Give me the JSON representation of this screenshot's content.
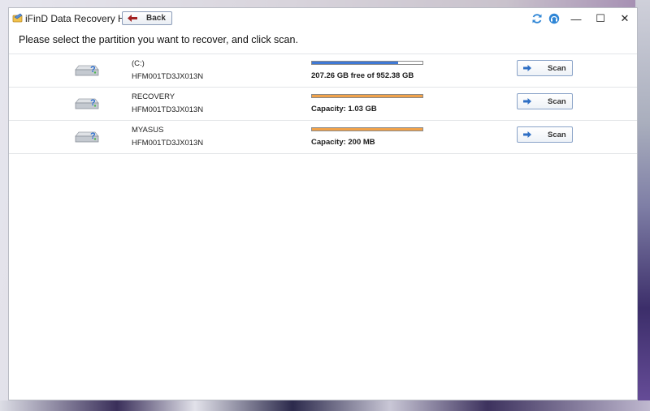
{
  "window": {
    "title": "iFinD Data Recovery Home",
    "back_label": "Back",
    "minimize": "—",
    "maximize": "☐",
    "close": "✕"
  },
  "instruction": "Please select the partition you want to recover, and click scan.",
  "partitions": [
    {
      "name": "(C:)",
      "model": "HFM001TD3JX013N",
      "capacity": "207.26 GB free of 952.38 GB",
      "used_fraction": 0.78,
      "bar_color": "#3f79d6",
      "scan_label": "Scan"
    },
    {
      "name": "RECOVERY",
      "model": "HFM001TD3JX013N",
      "capacity": "Capacity: 1.03 GB",
      "used_fraction": 1.0,
      "bar_color": "#f0a24a",
      "scan_label": "Scan"
    },
    {
      "name": "MYASUS",
      "model": "HFM001TD3JX013N",
      "capacity": "Capacity: 200 MB",
      "used_fraction": 1.0,
      "bar_color": "#f0a24a",
      "scan_label": "Scan"
    }
  ],
  "icons": {
    "app": "key-folder-icon",
    "refresh": "refresh-icon",
    "support": "headset-icon",
    "drive": "hard-drive-question-icon",
    "back_arrow": "back-arrow-icon",
    "scan_arrow": "forward-arrow-icon"
  }
}
